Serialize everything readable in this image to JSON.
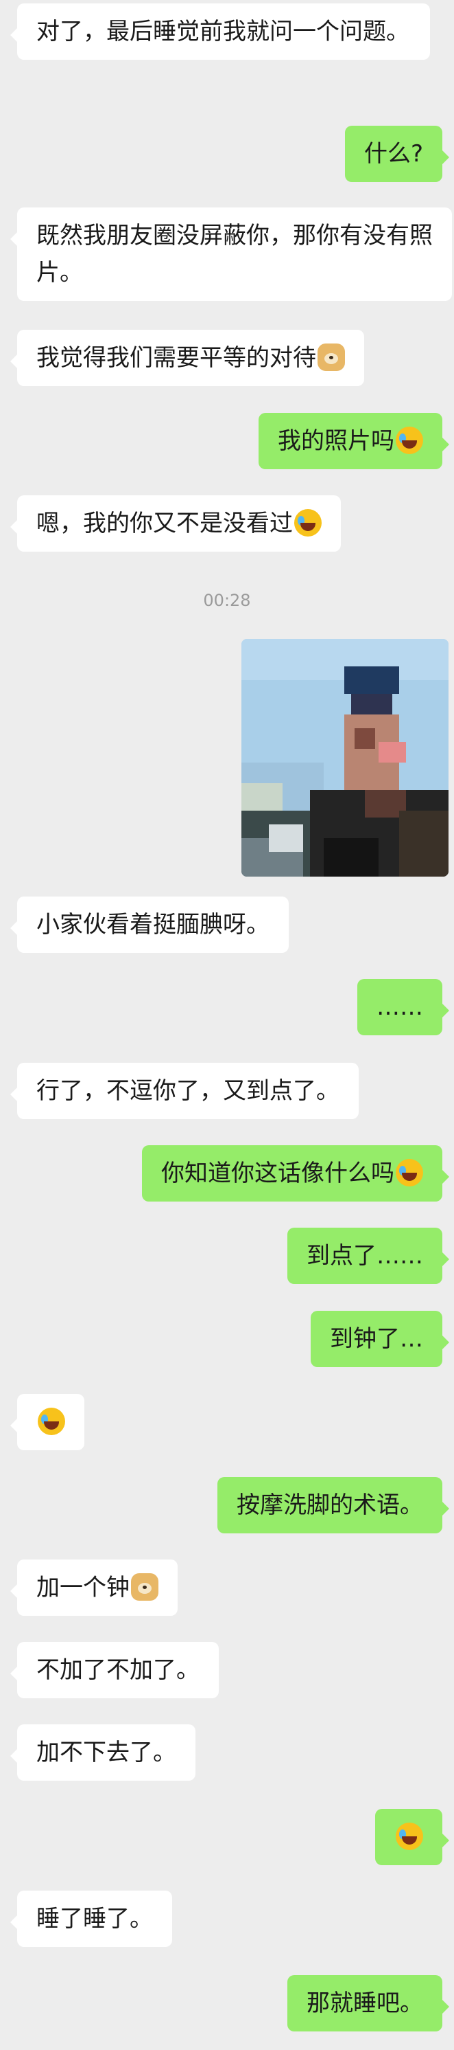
{
  "messages": [
    {
      "side": "left",
      "text": "对了，最后睡觉前我就问一个问题。"
    },
    {
      "side": "right",
      "text": "什么?"
    },
    {
      "side": "left",
      "text": "既然我朋友圈没屏蔽你，那你有没有照片。"
    },
    {
      "side": "left",
      "text": "我觉得我们需要平等的对待",
      "emoji": "doge-icon"
    },
    {
      "side": "right",
      "text": "我的照片吗",
      "emoji": "laugh-cry-icon"
    },
    {
      "side": "left",
      "text": "嗯，我的你又不是没看过",
      "emoji": "laugh-cry-icon"
    },
    {
      "side": "left",
      "text": "小家伙看着挺腼腆呀。"
    },
    {
      "side": "right",
      "text": "……"
    },
    {
      "side": "left",
      "text": "行了，不逗你了，又到点了。"
    },
    {
      "side": "right",
      "text": "你知道你这话像什么吗",
      "emoji": "laugh-cry-icon"
    },
    {
      "side": "right",
      "text": "到点了……"
    },
    {
      "side": "right",
      "text": "到钟了…"
    },
    {
      "side": "left",
      "text": "",
      "emoji": "laugh-cry-icon"
    },
    {
      "side": "right",
      "text": "按摩洗脚的术语。"
    },
    {
      "side": "left",
      "text": "加一个钟",
      "emoji": "doge-icon"
    },
    {
      "side": "left",
      "text": "不加了不加了。"
    },
    {
      "side": "left",
      "text": "加不下去了。"
    },
    {
      "side": "right",
      "text": "",
      "emoji": "laugh-cry-icon"
    },
    {
      "side": "left",
      "text": "睡了睡了。"
    },
    {
      "side": "right",
      "text": "那就睡吧。"
    }
  ],
  "timestamp": "00:28",
  "photo": {
    "subject": "pixelated-portrait",
    "colors": {
      "sky": "#a9cfe9",
      "shirt": "#2b2b2b",
      "skin": "#c08e7a"
    }
  },
  "colors": {
    "background": "#ededed",
    "left_bubble": "#ffffff",
    "right_bubble": "#95ec69"
  }
}
